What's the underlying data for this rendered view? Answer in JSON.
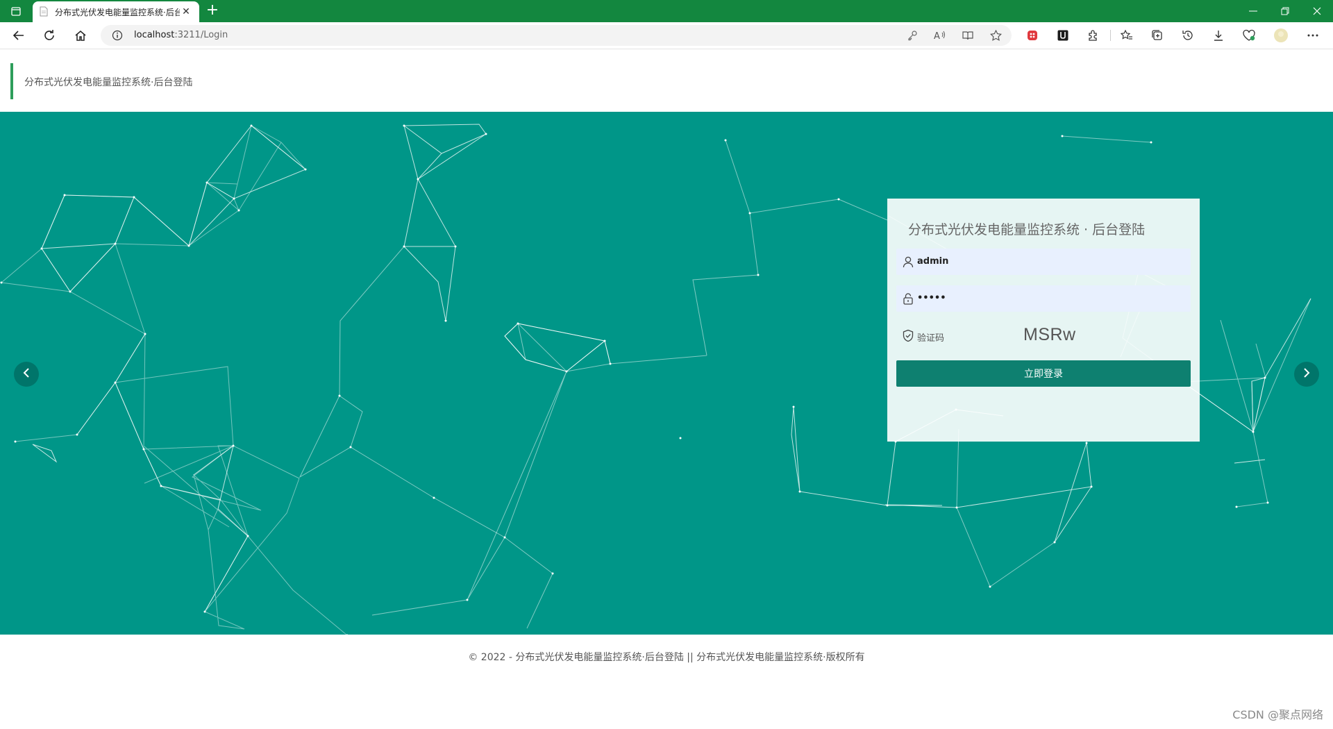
{
  "browser": {
    "tab_title": "分布式光伏发电能量监控系统·后台登陆",
    "url_host": "localhost",
    "url_path": ":3211/Login",
    "new_tab": "+",
    "tab_close": "✕"
  },
  "header": {
    "title": "分布式光伏发电能量监控系统·后台登陆"
  },
  "login": {
    "title": "分布式光伏发电能量监控系统 · 后台登陆",
    "username": "admin",
    "password_mask": "•••••",
    "captcha_label": "验证码",
    "captcha_code": "MSRw",
    "submit_label": "立即登录"
  },
  "footer": {
    "copyright": "© 2022 - 分布式光伏发电能量监控系统·后台登陆 || 分布式光伏发电能量监控系统·版权所有",
    "watermark": "CSDN @聚点网络"
  },
  "colors": {
    "chrome_green": "#13873f",
    "hero_teal": "#009688",
    "button_teal": "#0e8070",
    "header_accent": "#2e9e5b"
  },
  "icons": {
    "username": "user-icon",
    "password": "lock-icon",
    "captcha": "shield-check-icon",
    "carousel_prev": "chevron-left-icon",
    "carousel_next": "chevron-right-icon"
  }
}
